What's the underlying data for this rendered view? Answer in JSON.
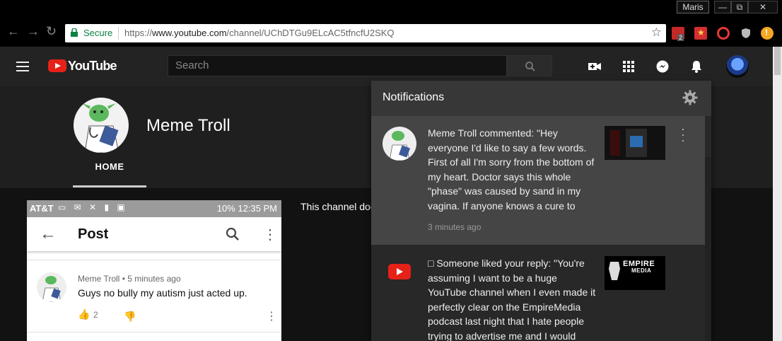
{
  "browser": {
    "profile_name": "Maris",
    "window_controls": [
      "—",
      "⧉",
      "✕"
    ],
    "secure_label": "Secure",
    "url_scheme": "https://",
    "url_host": "www.youtube.com",
    "url_path": "/channel/UChDTGu9ELcAC5tfncfU2SKQ",
    "extension_badge": "2"
  },
  "youtube": {
    "logo_text": "YouTube",
    "search_placeholder": "Search"
  },
  "channel": {
    "name": "Meme Troll",
    "tab_home": "HOME",
    "about_text": "This channel doe"
  },
  "phone": {
    "carrier": "AT&T",
    "status_right": "10%  12:35 PM",
    "appbar_title": "Post",
    "comment": {
      "author": "Meme Troll",
      "time": "5 minutes ago",
      "separator": "•",
      "text": "Guys no bully my autism just acted up.",
      "likes": "2"
    }
  },
  "notifications": {
    "title": "Notifications",
    "items": [
      {
        "text": "Meme Troll commented: \"Hey everyone I'd like to say a few words. First of all I'm sorry from the bottom of my heart. Doctor says this whole \"phase\" was caused by sand in my vagina. If anyone knows a cure to",
        "time": "3 minutes ago"
      },
      {
        "text": "□ Someone liked your reply: \"You're assuming I want to be a huge YouTube channel when I even made it perfectly clear on the EmpireMedia podcast last night that I hate people trying to advertise me and I would",
        "thumb_title": "EMPIRE",
        "thumb_sub": "MEDIA"
      }
    ]
  },
  "colors": {
    "youtube_red": "#e62117",
    "secure_green": "#0b8043",
    "masthead": "#232323"
  }
}
